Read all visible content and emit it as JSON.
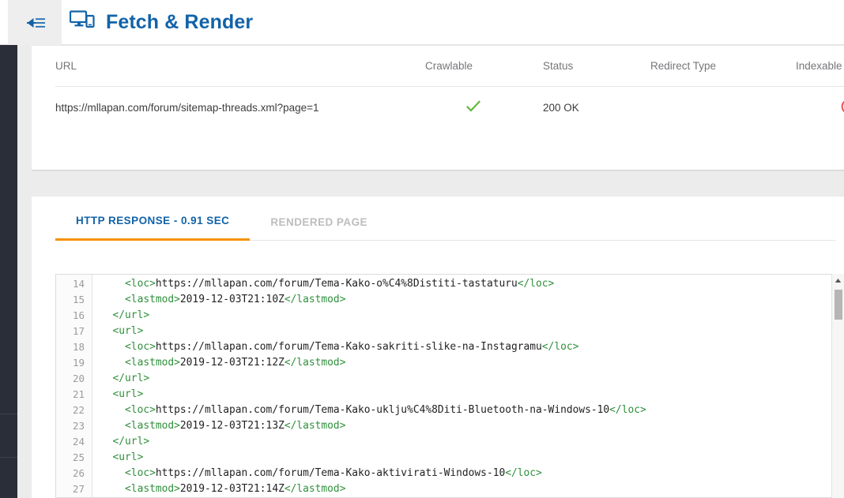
{
  "header": {
    "collapse_icon": "collapse-arrow-icon",
    "app_icon": "devices-icon",
    "title": "Fetch & Render"
  },
  "url_table": {
    "columns": [
      "URL",
      "Crawlable",
      "Status",
      "Redirect Type",
      "Indexable"
    ],
    "rows": [
      {
        "url": "https://mllapan.com/forum/sitemap-threads.xml?page=1",
        "crawlable_icon": "green-check-icon",
        "status": "200 OK",
        "redirect_type": "",
        "indexable_icon": "red-blocked-icon"
      }
    ]
  },
  "response_panel": {
    "tabs": [
      {
        "label": "HTTP RESPONSE - 0.91 SEC",
        "active": true
      },
      {
        "label": "RENDERED PAGE",
        "active": false
      }
    ],
    "code": {
      "first_line_number": 14,
      "lines": [
        {
          "n": "14",
          "segments": [
            {
              "t": "tag",
              "v": "    <loc>"
            },
            {
              "t": "text",
              "v": "https://mllapan.com/forum/Tema-Kako-o%C4%8Distiti-tastaturu"
            },
            {
              "t": "tag",
              "v": "</loc>"
            }
          ]
        },
        {
          "n": "15",
          "segments": [
            {
              "t": "tag",
              "v": "    <lastmod>"
            },
            {
              "t": "text",
              "v": "2019-12-03T21:10Z"
            },
            {
              "t": "tag",
              "v": "</lastmod>"
            }
          ]
        },
        {
          "n": "16",
          "segments": [
            {
              "t": "tag",
              "v": "  </url>"
            }
          ]
        },
        {
          "n": "17",
          "segments": [
            {
              "t": "tag",
              "v": "  <url>"
            }
          ]
        },
        {
          "n": "18",
          "segments": [
            {
              "t": "tag",
              "v": "    <loc>"
            },
            {
              "t": "text",
              "v": "https://mllapan.com/forum/Tema-Kako-sakriti-slike-na-Instagramu"
            },
            {
              "t": "tag",
              "v": "</loc>"
            }
          ]
        },
        {
          "n": "19",
          "segments": [
            {
              "t": "tag",
              "v": "    <lastmod>"
            },
            {
              "t": "text",
              "v": "2019-12-03T21:12Z"
            },
            {
              "t": "tag",
              "v": "</lastmod>"
            }
          ]
        },
        {
          "n": "20",
          "segments": [
            {
              "t": "tag",
              "v": "  </url>"
            }
          ]
        },
        {
          "n": "21",
          "segments": [
            {
              "t": "tag",
              "v": "  <url>"
            }
          ]
        },
        {
          "n": "22",
          "segments": [
            {
              "t": "tag",
              "v": "    <loc>"
            },
            {
              "t": "text",
              "v": "https://mllapan.com/forum/Tema-Kako-uklju%C4%8Diti-Bluetooth-na-Windows-10"
            },
            {
              "t": "tag",
              "v": "</loc>"
            }
          ]
        },
        {
          "n": "23",
          "segments": [
            {
              "t": "tag",
              "v": "    <lastmod>"
            },
            {
              "t": "text",
              "v": "2019-12-03T21:13Z"
            },
            {
              "t": "tag",
              "v": "</lastmod>"
            }
          ]
        },
        {
          "n": "24",
          "segments": [
            {
              "t": "tag",
              "v": "  </url>"
            }
          ]
        },
        {
          "n": "25",
          "segments": [
            {
              "t": "tag",
              "v": "  <url>"
            }
          ]
        },
        {
          "n": "26",
          "segments": [
            {
              "t": "tag",
              "v": "    <loc>"
            },
            {
              "t": "text",
              "v": "https://mllapan.com/forum/Tema-Kako-aktivirati-Windows-10"
            },
            {
              "t": "tag",
              "v": "</loc>"
            }
          ]
        },
        {
          "n": "27",
          "segments": [
            {
              "t": "tag",
              "v": "    <lastmod>"
            },
            {
              "t": "text",
              "v": "2019-12-03T21:14Z"
            },
            {
              "t": "tag",
              "v": "</lastmod>"
            }
          ]
        }
      ]
    },
    "scrollbar": {
      "up_arrow_icon": "scroll-up-arrow-icon"
    }
  },
  "colors": {
    "accent_orange": "#f59200",
    "title_blue": "#1263a8",
    "tag_green": "#2f8f3c",
    "ok_green": "#5cb531",
    "blocked_red": "#f0534f",
    "sidebar_dark": "#2a2e38",
    "page_grey": "#ececed"
  }
}
